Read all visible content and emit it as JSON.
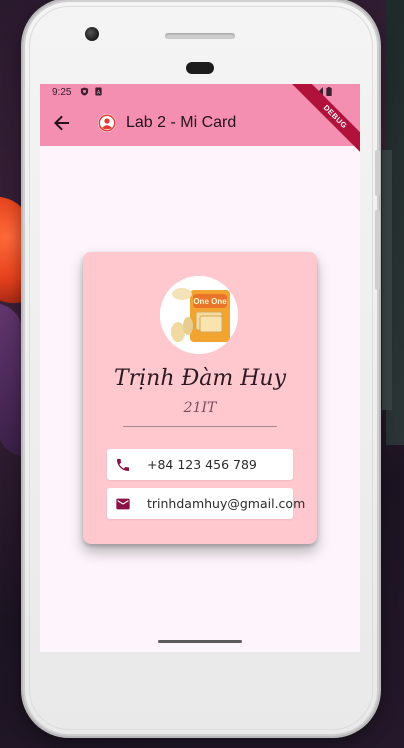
{
  "status_bar": {
    "time": "9:25",
    "icons": [
      "shield-icon",
      "sim-card-icon",
      "wifi-icon",
      "signal-icon",
      "battery-icon"
    ]
  },
  "app_bar": {
    "back_icon": "arrow-back-icon",
    "title_icon": "account-circle-icon",
    "title": "Lab 2 - Mi Card",
    "debug_banner": "DEBUG",
    "color": "#f48fb1"
  },
  "card": {
    "name": "Trịnh Đàm Huy",
    "subtitle": "21IT",
    "background_color": "#ffc8cf",
    "avatar_text": "One One",
    "phone": {
      "icon": "phone-icon",
      "text": "+84 123 456 789"
    },
    "email": {
      "icon": "email-icon",
      "text": "trinhdamhuy@gmail.com"
    },
    "accent_color": "#8c1246"
  },
  "screen_background": "#fdf5fb"
}
